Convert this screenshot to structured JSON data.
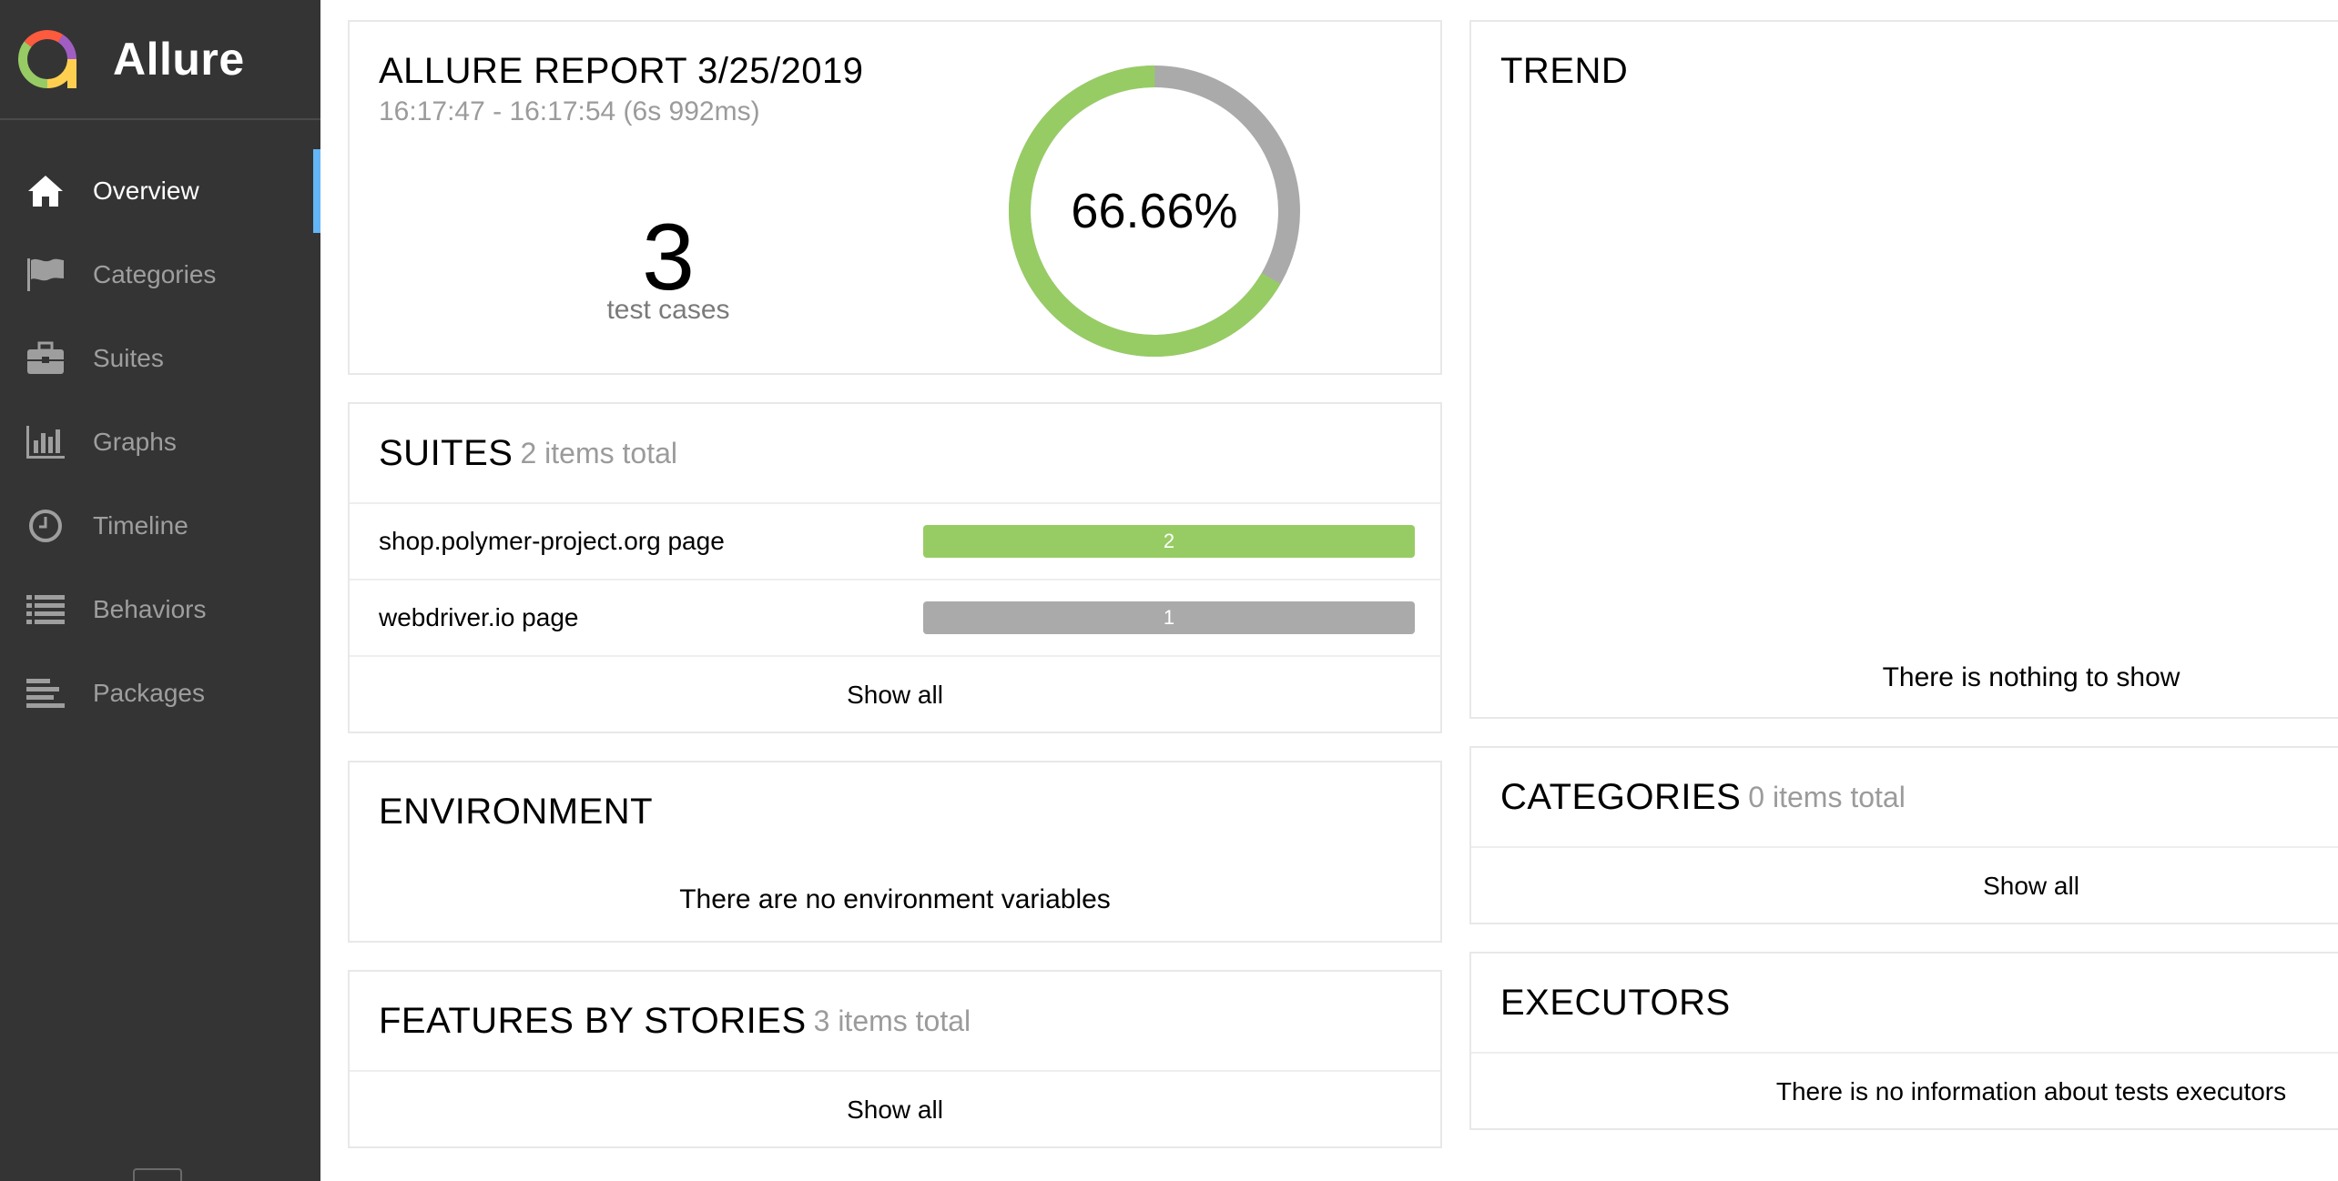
{
  "brand": {
    "name": "Allure"
  },
  "nav": {
    "items": [
      {
        "label": "Overview",
        "icon": "home-icon",
        "active": true
      },
      {
        "label": "Categories",
        "icon": "flag-icon"
      },
      {
        "label": "Suites",
        "icon": "briefcase-icon"
      },
      {
        "label": "Graphs",
        "icon": "bar-chart-icon"
      },
      {
        "label": "Timeline",
        "icon": "clock-icon"
      },
      {
        "label": "Behaviors",
        "icon": "list-icon"
      },
      {
        "label": "Packages",
        "icon": "align-left-icon"
      }
    ]
  },
  "summary": {
    "title": "ALLURE REPORT 3/25/2019",
    "time": "16:17:47 - 16:17:54 (6s 992ms)",
    "count": "3",
    "count_label": "test cases",
    "percent": "66.66%",
    "passed_fraction": 0.6666
  },
  "suites": {
    "title": "SUITES",
    "count": "2 items total",
    "rows": [
      {
        "name": "shop.polymer-project.org page",
        "value": "2",
        "color": "#97cc64"
      },
      {
        "name": "webdriver.io page",
        "value": "1",
        "color": "#aaaaaa"
      }
    ],
    "show_all": "Show all"
  },
  "environment": {
    "title": "ENVIRONMENT",
    "empty": "There are no environment variables"
  },
  "features": {
    "title": "FEATURES BY STORIES",
    "count": "3 items total",
    "show_all": "Show all"
  },
  "trend": {
    "title": "TREND",
    "empty": "There is nothing to show"
  },
  "categories": {
    "title": "CATEGORIES",
    "count": "0 items total",
    "show_all": "Show all"
  },
  "executors": {
    "title": "EXECUTORS",
    "empty": "There is no information about tests executors"
  },
  "colors": {
    "sidebar": "#343434",
    "passed": "#97cc64",
    "other": "#aaaaaa",
    "accent": "#64b5f6"
  }
}
